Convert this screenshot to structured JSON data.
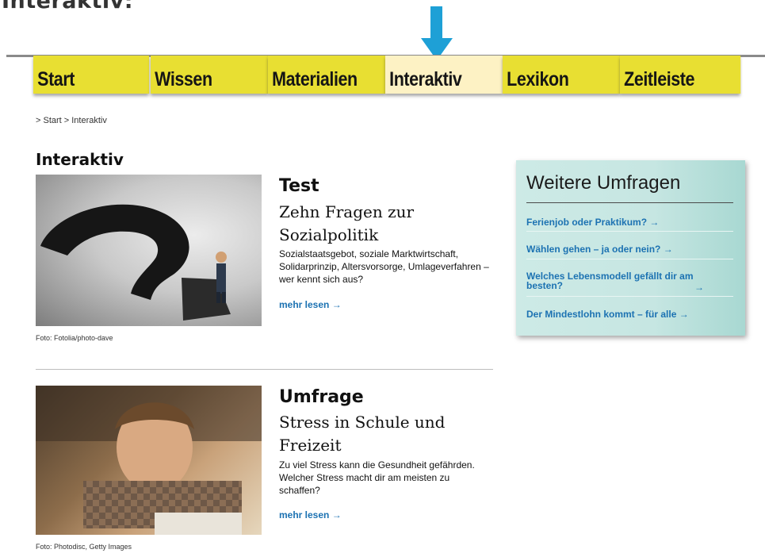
{
  "top_caption": "Interaktiv:",
  "nav": {
    "tabs": [
      {
        "label": "Start",
        "active": false
      },
      {
        "label": "Wissen",
        "active": false
      },
      {
        "label": "Materialien",
        "active": false
      },
      {
        "label": "Interaktiv",
        "active": true
      },
      {
        "label": "Lexikon",
        "active": false
      },
      {
        "label": "Zeitleiste",
        "active": false
      }
    ]
  },
  "breadcrumb": "> Start > Interaktiv",
  "section_title": "Interaktiv",
  "articles": [
    {
      "kind": "Test",
      "headline": "Zehn Fragen zur Sozialpolitik",
      "teaser": "Sozialstaatsgebot, soziale Marktwirtschaft, Solidarprinzip, Altersvorsorge, Umlageverfahren – wer kennt sich aus?",
      "more": "mehr lesen →",
      "credit": "Foto: Fotolia/photo-dave"
    },
    {
      "kind": "Umfrage",
      "headline": "Stress in Schule und Freizeit",
      "teaser": "Zu viel Stress kann die Gesundheit gefährden. Welcher Stress macht dir am meisten zu schaffen?",
      "more": "mehr lesen →",
      "credit": "Foto: Photodisc, Getty Images"
    }
  ],
  "sidebox": {
    "title": "Weitere Umfragen",
    "items": [
      "Ferienjob oder Praktikum? →",
      "Wählen gehen – ja oder nein? →",
      "Welches Lebensmodell gefällt dir am besten?",
      "Der Mindestlohn kommt – für alle →"
    ],
    "item3_arrow": "→"
  },
  "colors": {
    "nav_tab": "#e8df32",
    "nav_active": "#fdf2c4",
    "link": "#1c72b2",
    "indicator_arrow": "#1ea0d6",
    "sidebox_bg": "#c6e6e2"
  }
}
